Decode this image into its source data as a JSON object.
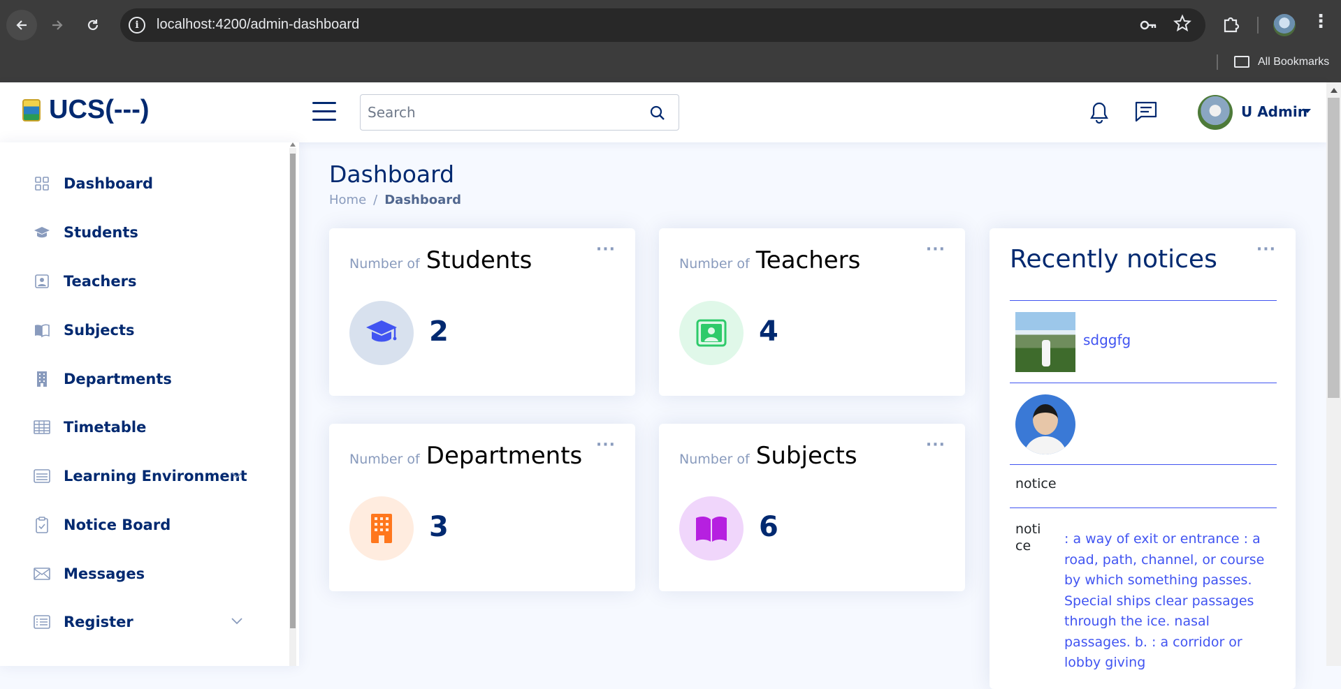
{
  "browser": {
    "url": "localhost:4200/admin-dashboard",
    "bookmarks_label": "All Bookmarks"
  },
  "header": {
    "logo_text": "UCS(---)",
    "search_placeholder": "Search",
    "user_name": "U Admin"
  },
  "sidebar": {
    "items": [
      {
        "label": "Dashboard",
        "icon": "grid-icon"
      },
      {
        "label": "Students",
        "icon": "mortarboard-icon"
      },
      {
        "label": "Teachers",
        "icon": "person-badge-icon"
      },
      {
        "label": "Subjects",
        "icon": "book-icon"
      },
      {
        "label": "Departments",
        "icon": "building-icon"
      },
      {
        "label": "Timetable",
        "icon": "table-icon"
      },
      {
        "label": "Learning Environment",
        "icon": "menu-icon",
        "expandable": true
      },
      {
        "label": "Notice Board",
        "icon": "clipboard-check-icon"
      },
      {
        "label": "Messages",
        "icon": "envelope-icon"
      },
      {
        "label": "Register",
        "icon": "list-icon",
        "expandable": true
      }
    ]
  },
  "main": {
    "title": "Dashboard",
    "breadcrumb": {
      "home": "Home",
      "separator": "/",
      "current": "Dashboard"
    },
    "cards": [
      {
        "prefix": "Number of",
        "label": "Students",
        "value": "2",
        "icon": "mortarboard-icon",
        "accent": "#4154f1",
        "bg": "#d8e1ee"
      },
      {
        "prefix": "Number of",
        "label": "Teachers",
        "value": "4",
        "icon": "person-video-icon",
        "accent": "#2eca6a",
        "bg": "#e0f8e9"
      },
      {
        "prefix": "Number of",
        "label": "Departments",
        "value": "3",
        "icon": "building-icon",
        "accent": "#ff771d",
        "bg": "#ffecdf"
      },
      {
        "prefix": "Number of",
        "label": "Subjects",
        "value": "6",
        "icon": "book-open-icon",
        "accent": "#b620e0",
        "bg": "#f0d6fb"
      }
    ],
    "card_menu": "···",
    "notices": {
      "title": "Recently notices",
      "items": [
        {
          "type": "image-link",
          "link_text": "sdggfg"
        },
        {
          "type": "image"
        },
        {
          "type": "broken-image",
          "alt": "notice"
        },
        {
          "type": "broken-image-text",
          "alt_line1": "noti",
          "alt_line2": "ce",
          "text": ": a way of exit or entrance : a road, path, channel, or course by which something passes. Special ships clear passages through the ice. nasal passages. b. : a corridor or lobby giving"
        }
      ]
    }
  }
}
